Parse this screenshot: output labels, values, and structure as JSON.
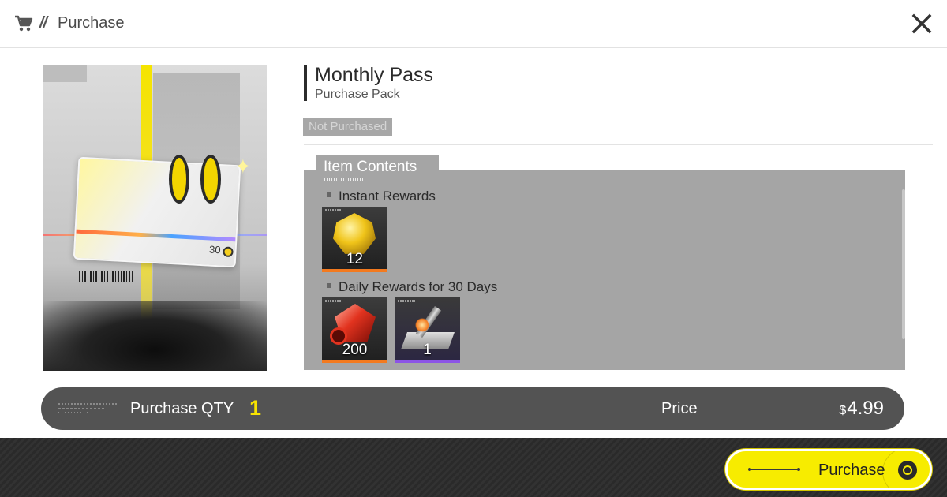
{
  "header": {
    "slashes": "//",
    "title": "Purchase",
    "cart_icon": "cart-icon",
    "close_icon": "close-icon"
  },
  "item": {
    "title": "Monthly Pass",
    "subtitle": "Purchase Pack",
    "status": "Not Purchased",
    "art_card_number": "30"
  },
  "contents": {
    "tab_label": "Item Contents",
    "sections": [
      {
        "label": "Instant Rewards",
        "rewards": [
          {
            "icon": "gold-crystal-icon",
            "qty": "12",
            "rarity": "orange"
          }
        ]
      },
      {
        "label": "Daily Rewards for 30 Days",
        "rewards": [
          {
            "icon": "red-gem-icon",
            "qty": "200",
            "rarity": "orange"
          },
          {
            "icon": "key-icon",
            "qty": "1",
            "rarity": "purple"
          }
        ]
      }
    ]
  },
  "purchase_bar": {
    "qty_label": "Purchase QTY",
    "qty_value": "1",
    "price_label": "Price",
    "currency": "$",
    "price_value": "4.99"
  },
  "footer": {
    "purchase_button": "Purchase"
  },
  "colors": {
    "accent_yellow": "#f7ec00",
    "rarity_orange": "#f37a1f",
    "rarity_purple": "#8c54e6",
    "bar_bg": "#535353",
    "panel_bg": "#a5a5a5"
  }
}
